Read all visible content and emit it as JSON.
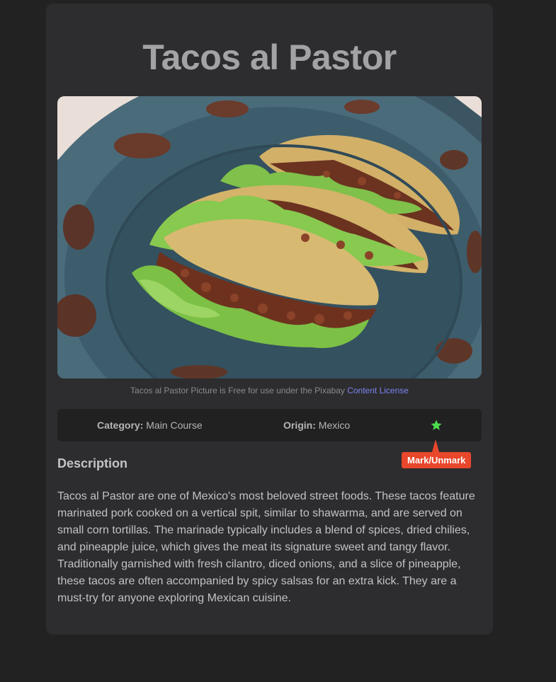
{
  "recipe": {
    "title": "Tacos al Pastor",
    "image_alt": "Tacos al Pastor",
    "credit_text": "Tacos al Pastor Picture is Free for use under the Pixabay",
    "credit_link": "Content License",
    "category_label": "Category:",
    "category_value": "Main Course",
    "origin_label": "Origin:",
    "origin_value": "Mexico",
    "favorite_icon": "star-icon",
    "favorite_marked": true,
    "tooltip": "Mark/Unmark",
    "description_heading": "Description",
    "description": "Tacos al Pastor are one of Mexico's most beloved street foods. These tacos feature marinated pork cooked on a vertical spit, similar to shawarma, and are served on small corn tortillas. The marinade typically includes a blend of spices, dried chilies, and pineapple juice, which gives the meat its signature sweet and tangy flavor. Traditionally garnished with fresh cilantro, diced onions, and a slice of pineapple, these tacos are often accompanied by spicy salsas for an extra kick. They are a must-try for anyone exploring Mexican cuisine."
  },
  "colors": {
    "page_background": "#222223",
    "card_background": "#2d2c2e",
    "title": "#a3a3a5",
    "link": "#7d84f4",
    "star_marked": "#4ddc4d",
    "tooltip_background": "#e8472b"
  }
}
